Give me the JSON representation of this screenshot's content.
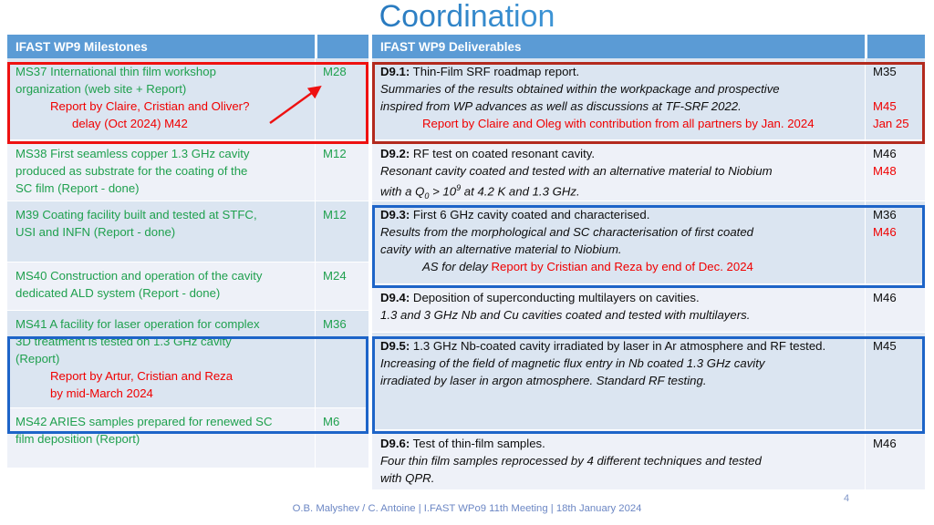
{
  "slide": {
    "title": "Coordination",
    "page_number": "4",
    "footer": "O.B. Malyshev / C. Antoine | I.FAST WPo9 11th Meeting | 18th January 2024",
    "title_gradient_from": "#1f6eb5",
    "title_gradient_to": "#56a3dc"
  },
  "colors": {
    "header_band": "#5b9bd5",
    "row_light": "#eef1f8",
    "row_dark": "#dbe5f1",
    "green_text": "#1fa04e",
    "red_text": "#f00000",
    "black_text": "#0d0d0d",
    "red_box": "#ee1111",
    "darkred_box": "#b32a1e",
    "blue_box": "#1d64c8",
    "footer_text": "#6c87c4"
  },
  "milestones": {
    "header": "IFAST WP9 Milestones",
    "header_code": "",
    "rows": [
      {
        "lines": [
          {
            "text": "MS37 International thin film workshop",
            "color": "green",
            "indent": 0
          },
          {
            "text": "organization (web site + Report)",
            "color": "green",
            "indent": 0
          },
          {
            "text": "Report by Claire, Cristian and Oliver?",
            "color": "red",
            "indent": 1
          },
          {
            "text": "delay  (Oct 2024) M42",
            "color": "red",
            "indent": 2
          }
        ],
        "code": "M28",
        "code_color": "green",
        "highlight": "red"
      },
      {
        "lines": [
          {
            "text": "MS38 First seamless copper 1.3 GHz cavity",
            "color": "green",
            "indent": 0
          },
          {
            "text": "produced as substrate for the coating of the",
            "color": "green",
            "indent": 0
          },
          {
            "text": "SC film (Report - done)",
            "color": "green",
            "indent": 0
          }
        ],
        "code": "M12",
        "code_color": "green",
        "highlight": ""
      },
      {
        "lines": [
          {
            "text": "M39 Coating facility built and tested at STFC,",
            "color": "green",
            "indent": 0
          },
          {
            "text": "USI and INFN (Report - done)",
            "color": "green",
            "indent": 0
          }
        ],
        "code": "M12",
        "code_color": "green",
        "highlight": ""
      },
      {
        "lines": [
          {
            "text": "MS40 Construction and operation of the cavity",
            "color": "green",
            "indent": 0
          },
          {
            "text": "dedicated ALD system (Report - done)",
            "color": "green",
            "indent": 0
          }
        ],
        "code": "M24",
        "code_color": "green",
        "highlight": ""
      },
      {
        "lines": [
          {
            "text": "MS41 A facility for laser operation for complex",
            "color": "green",
            "indent": 0
          },
          {
            "text": "3D treatment is tested on 1.3 GHz cavity",
            "color": "green",
            "indent": 0
          },
          {
            "text": "(Report)",
            "color": "green",
            "indent": 0
          },
          {
            "text": "Report by Artur, Cristian and Reza",
            "color": "red",
            "indent": 1
          },
          {
            "text": "by mid-March 2024",
            "color": "red",
            "indent": 1
          }
        ],
        "code": "M36",
        "code_color": "green",
        "highlight": "blue"
      },
      {
        "lines": [
          {
            "text": "MS42 ARIES samples prepared for renewed SC",
            "color": "green",
            "indent": 0
          },
          {
            "text": "film deposition (Report)",
            "color": "green",
            "indent": 0
          }
        ],
        "code": "M6",
        "code_color": "green",
        "highlight": ""
      }
    ]
  },
  "deliverables": {
    "header": "IFAST WP9 Deliverables",
    "header_code": "",
    "rows": [
      {
        "id": "D9.1:",
        "title": " Thin-Film SRF roadmap report.",
        "lines": [
          {
            "text": "Summaries of the results obtained within the workpackage and prospective",
            "color": "black",
            "style": "ital",
            "indent": 0
          },
          {
            "text": "inspired from WP advances as well as discussions at TF-SRF 2022.",
            "color": "black",
            "style": "ital",
            "indent": 0
          },
          {
            "text": "Report by Claire and Oleg with contribution from all partners by Jan. 2024",
            "color": "red",
            "style": "",
            "indent": 3
          }
        ],
        "codes": [
          {
            "text": "M35",
            "color": "black"
          },
          {
            "text": "",
            "color": "black"
          },
          {
            "text": "M45",
            "color": "red"
          },
          {
            "text": "Jan 25",
            "color": "red"
          }
        ],
        "highlight": "darkred"
      },
      {
        "id": "D9.2:",
        "title": " RF test on coated resonant cavity.",
        "lines": [
          {
            "text": "Resonant cavity coated and tested with an alternative material to Niobium",
            "color": "black",
            "style": "ital",
            "indent": 0
          },
          {
            "text": "with a Q0 > 109 at 4.2 K and 1.3 GHz.",
            "color": "black",
            "style": "ital",
            "indent": 0,
            "math": true
          }
        ],
        "codes": [
          {
            "text": "M46",
            "color": "black"
          },
          {
            "text": "M48",
            "color": "red"
          }
        ],
        "highlight": ""
      },
      {
        "id": "D9.3:",
        "title": " First 6 GHz cavity coated and characterised.",
        "lines": [
          {
            "text": "Results from the morphological and SC characterisation of first coated",
            "color": "black",
            "style": "ital",
            "indent": 0
          },
          {
            "text": "cavity with an alternative material to Niobium.",
            "color": "black",
            "style": "ital",
            "indent": 0
          },
          {
            "text": "AS for delay ",
            "color": "black",
            "style": "ital",
            "indent": 3,
            "suffix": "Report by Cristian and Reza by end of Dec. 2024",
            "suffix_color": "red"
          }
        ],
        "codes": [
          {
            "text": "M36",
            "color": "black"
          },
          {
            "text": "M46",
            "color": "red"
          }
        ],
        "highlight": "blue"
      },
      {
        "id": "D9.4:",
        "title": " Deposition of superconducting multilayers on cavities.",
        "lines": [
          {
            "text": "1.3 and 3 GHz Nb and Cu cavities coated and tested with multilayers.",
            "color": "black",
            "style": "ital",
            "indent": 0
          }
        ],
        "codes": [
          {
            "text": "M46",
            "color": "black"
          }
        ],
        "highlight": ""
      },
      {
        "id": "D9.5:",
        "title": " 1.3 GHz Nb-coated cavity irradiated by laser in Ar atmosphere and RF tested.",
        "lines": [
          {
            "text": "Increasing of the field of magnetic flux entry in Nb coated 1.3 GHz cavity",
            "color": "black",
            "style": "ital",
            "indent": 0
          },
          {
            "text": "irradiated by laser in argon atmosphere. Standard RF testing.",
            "color": "black",
            "style": "ital",
            "indent": 0
          }
        ],
        "codes": [
          {
            "text": "M45",
            "color": "black"
          }
        ],
        "highlight": "blue"
      },
      {
        "id": "D9.6:",
        "title": " Test of thin-film samples.",
        "lines": [
          {
            "text": "Four thin film samples reprocessed by 4 different techniques and tested",
            "color": "black",
            "style": "ital",
            "indent": 0
          },
          {
            "text": "with QPR.",
            "color": "black",
            "style": "ital",
            "indent": 0
          }
        ],
        "codes": [
          {
            "text": "M46",
            "color": "black"
          }
        ],
        "highlight": ""
      }
    ]
  }
}
